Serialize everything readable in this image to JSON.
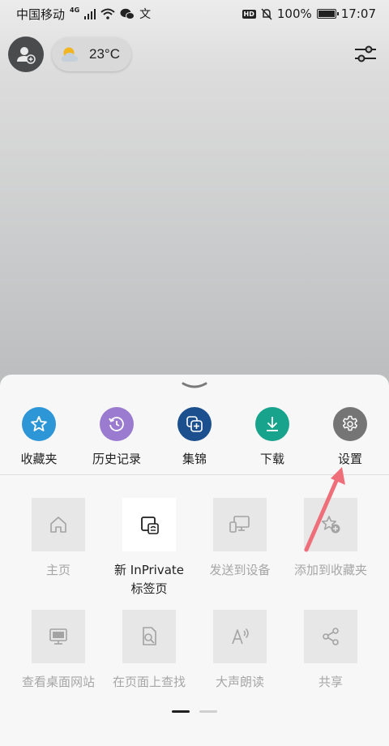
{
  "status_bar": {
    "carrier": "中国移动",
    "signal": "4G",
    "battery": "100%",
    "battery_level": 1.0,
    "time": "17:07"
  },
  "top_bar": {
    "temperature": "23°C"
  },
  "quick_actions": [
    {
      "label": "收藏夹",
      "icon": "star-icon",
      "color": "#2d96d6"
    },
    {
      "label": "历史记录",
      "icon": "history-icon",
      "color": "#9a7bcf"
    },
    {
      "label": "集锦",
      "icon": "collections-icon",
      "color": "#1b4f8d"
    },
    {
      "label": "下载",
      "icon": "download-icon",
      "color": "#18a38c"
    },
    {
      "label": "设置",
      "icon": "gear-icon",
      "color": "#757575"
    }
  ],
  "grid": {
    "row1": [
      {
        "label": "主页",
        "icon": "home-icon",
        "enabled": false
      },
      {
        "label_line1": "新 InPrivate",
        "label_line2": "标签页",
        "icon": "inprivate-tab-icon",
        "enabled": true
      },
      {
        "label": "发送到设备",
        "icon": "send-to-device-icon",
        "enabled": false
      },
      {
        "label": "添加到收藏夹",
        "icon": "add-favorite-icon",
        "enabled": false
      }
    ],
    "row2": [
      {
        "label": "查看桌面网站",
        "icon": "desktop-site-icon",
        "enabled": false
      },
      {
        "label": "在页面上查找",
        "icon": "find-on-page-icon",
        "enabled": false
      },
      {
        "label": "大声朗读",
        "icon": "read-aloud-icon",
        "enabled": false
      },
      {
        "label": "共享",
        "icon": "share-icon",
        "enabled": false
      }
    ]
  },
  "pager": {
    "pages": 2,
    "current": 1
  },
  "annotation_color": "#ee6e7a"
}
